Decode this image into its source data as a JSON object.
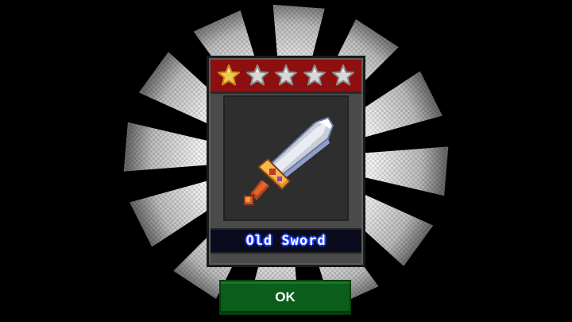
{
  "item": {
    "name": "Old Sword",
    "rarity_stars": 1,
    "max_stars": 5
  },
  "ok_button": {
    "label": "OK"
  },
  "colors": {
    "background": "#000000",
    "card_body": "#4a4a4a",
    "rarity_bar": "#8d0f0f",
    "star_filled": "#f2c84b",
    "star_empty": "#d8d8d8",
    "ok_button": "#0a5d1b",
    "name_strip": "#0b0b1f"
  },
  "icons": {
    "item_icon": "sword-icon",
    "rarity_icon": "star-icon",
    "background_effect": "radial-light-burst"
  }
}
